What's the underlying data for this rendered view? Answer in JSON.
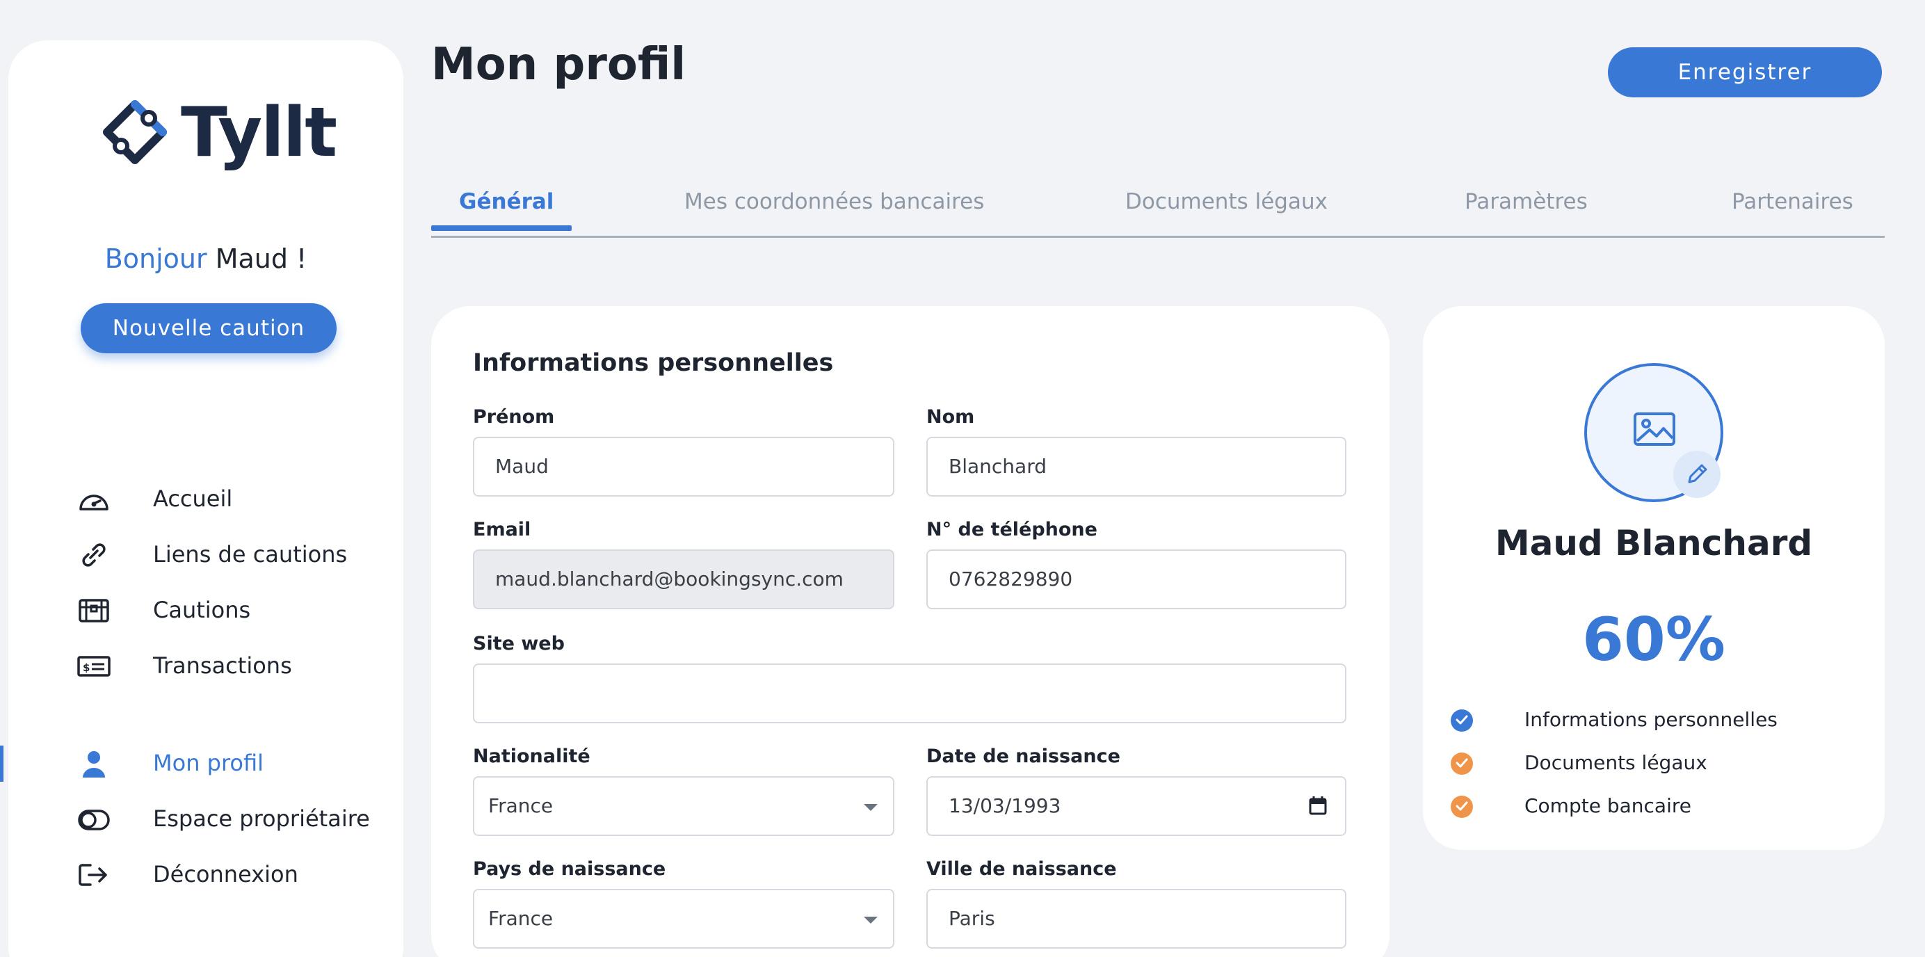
{
  "app": {
    "logo_text": "Tyllt"
  },
  "sidebar": {
    "greeting_hello": "Bonjour",
    "greeting_name": "Maud !",
    "new_button": "Nouvelle caution",
    "items": [
      {
        "label": "Accueil",
        "icon": "speedometer-icon",
        "active": false
      },
      {
        "label": "Liens de cautions",
        "icon": "link-icon",
        "active": false
      },
      {
        "label": "Cautions",
        "icon": "treasure-chest-icon",
        "active": false
      },
      {
        "label": "Transactions",
        "icon": "banknote-icon",
        "active": false
      },
      {
        "label": "Mon profil",
        "icon": "user-icon",
        "active": true
      },
      {
        "label": "Espace propriétaire",
        "icon": "toggle-icon",
        "active": false
      },
      {
        "label": "Déconnexion",
        "icon": "logout-icon",
        "active": false
      }
    ]
  },
  "header": {
    "title": "Mon profil",
    "save_button": "Enregistrer"
  },
  "tabs": [
    {
      "label": "Général",
      "active": true
    },
    {
      "label": "Mes coordonnées bancaires",
      "active": false
    },
    {
      "label": "Documents légaux",
      "active": false
    },
    {
      "label": "Paramètres",
      "active": false
    },
    {
      "label": "Partenaires",
      "active": false
    }
  ],
  "form": {
    "section_title": "Informations personnelles",
    "first_name": {
      "label": "Prénom",
      "value": "Maud"
    },
    "last_name": {
      "label": "Nom",
      "value": "Blanchard"
    },
    "email": {
      "label": "Email",
      "value": "maud.blanchard@bookingsync.com"
    },
    "phone": {
      "label": "N° de téléphone",
      "value": "0762829890"
    },
    "website": {
      "label": "Site web",
      "value": ""
    },
    "nationality": {
      "label": "Nationalité",
      "value": "France"
    },
    "birth_date": {
      "label": "Date de naissance",
      "value": "13/03/1993"
    },
    "birth_country": {
      "label": "Pays de naissance",
      "value": "France"
    },
    "birth_city": {
      "label": "Ville de naissance",
      "value": "Paris"
    }
  },
  "profile": {
    "name": "Maud Blanchard",
    "completion": "60%",
    "checklist": [
      {
        "label": "Informations personnelles",
        "status": "done",
        "color": "#3a78d6"
      },
      {
        "label": "Documents légaux",
        "status": "pending",
        "color": "#f0944a"
      },
      {
        "label": "Compte bancaire",
        "status": "pending",
        "color": "#f0944a"
      }
    ]
  },
  "colors": {
    "accent": "#3a78d6",
    "pending": "#f0944a",
    "background": "#f1f3f7"
  }
}
